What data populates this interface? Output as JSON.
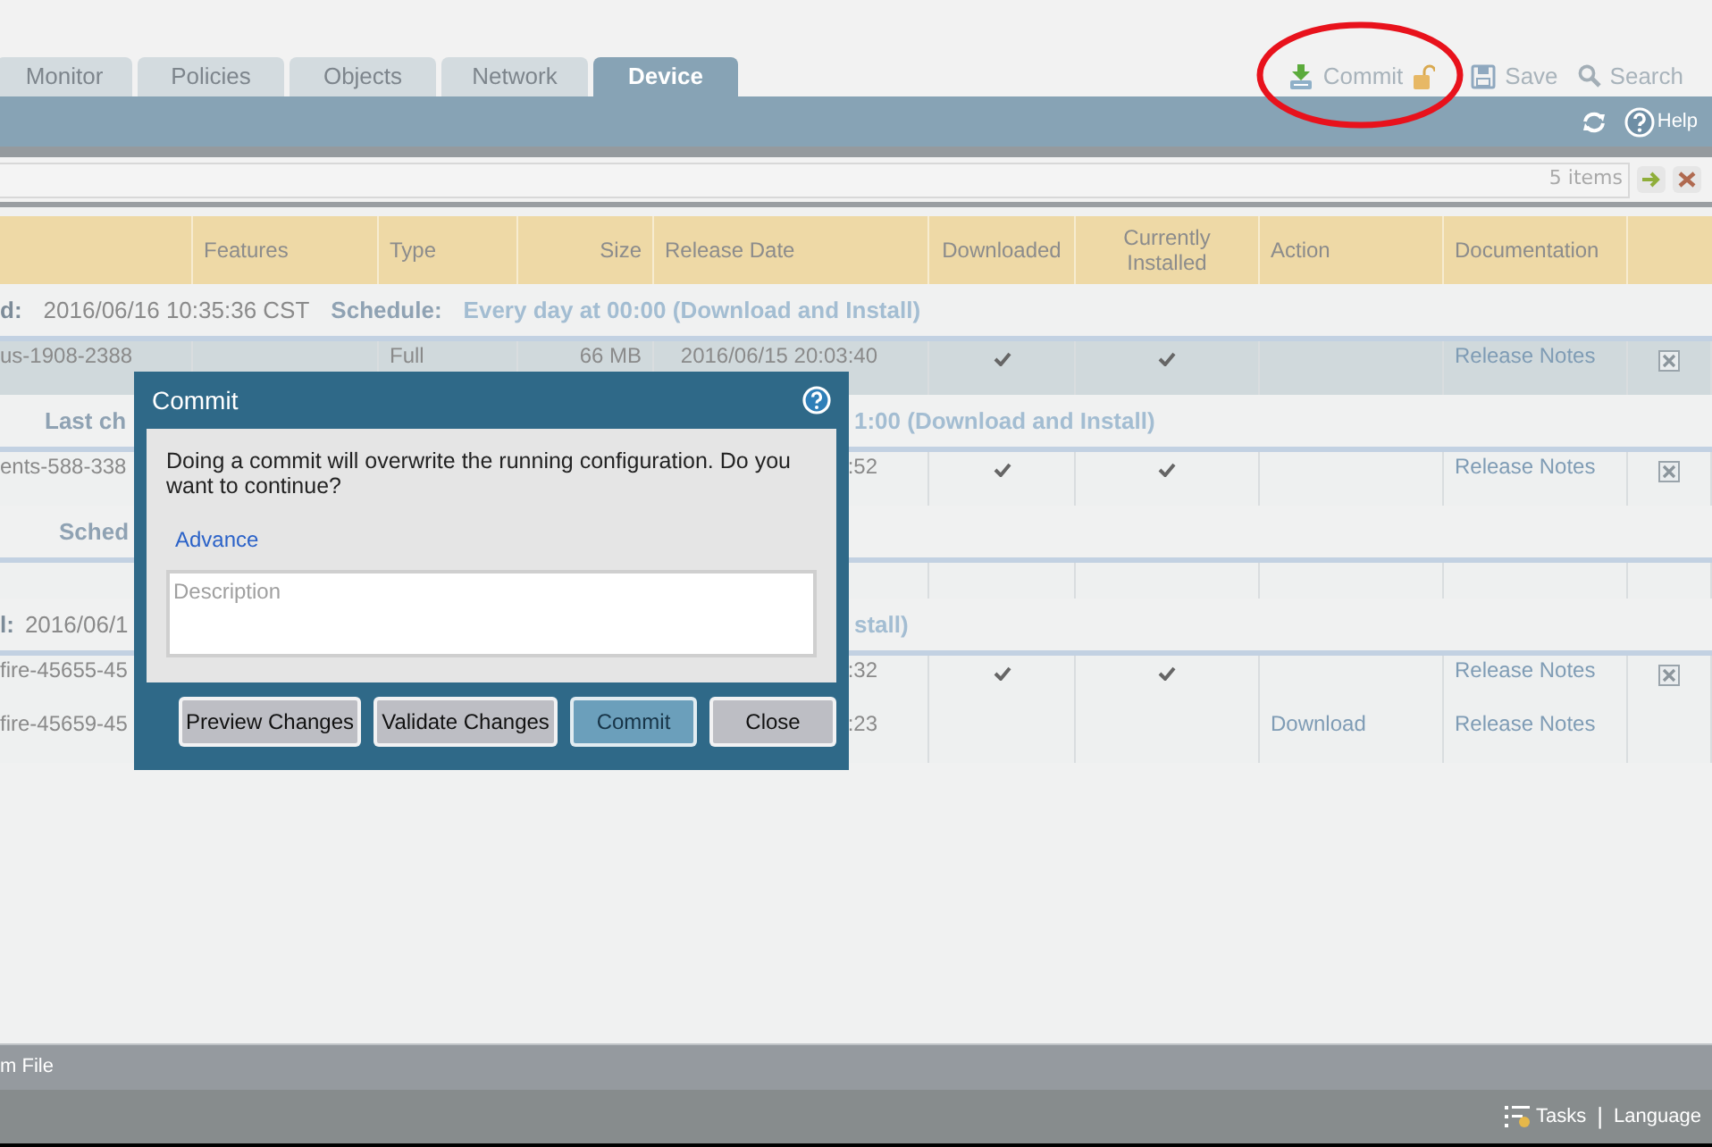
{
  "tabs": [
    {
      "label": "Monitor",
      "selected": false
    },
    {
      "label": "Policies",
      "selected": false
    },
    {
      "label": "Objects",
      "selected": false
    },
    {
      "label": "Network",
      "selected": false
    },
    {
      "label": "Device",
      "selected": true
    }
  ],
  "toolbar": {
    "commit": "Commit",
    "save": "Save",
    "search": "Search"
  },
  "subbar": {
    "help": "Help"
  },
  "filter": {
    "count": "5 items"
  },
  "table": {
    "columns": [
      "Features",
      "Type",
      "Size",
      "Release Date",
      "Downloaded",
      "Currently Installed",
      "Action",
      "Documentation"
    ],
    "rows": [
      {
        "kind": "group",
        "left": [
          {
            "text": "d:",
            "kind": "label"
          },
          {
            "text": "2016/06/16 10:35:36 CST",
            "kind": "value"
          },
          {
            "text": "Schedule:",
            "kind": "key"
          },
          {
            "text": "Every day at 00:00 (Download and Install)",
            "kind": "schedule"
          }
        ]
      },
      {
        "kind": "row",
        "selected": true,
        "name": "us-1908-2388",
        "type": "Full",
        "size": "66 MB",
        "date": "2016/06/15 20:03:40",
        "downloaded": true,
        "installed": true,
        "doc": "Release Notes",
        "removable": true
      },
      {
        "kind": "group",
        "left": [
          {
            "text": "Last ch",
            "kind": "key"
          }
        ],
        "right": [
          {
            "text": "1:00 (Download and Install)",
            "kind": "schedule"
          }
        ]
      },
      {
        "kind": "row",
        "selected": false,
        "name": "ents-588-338",
        "date": ":52",
        "downloaded": true,
        "installed": true,
        "doc": "Release Notes",
        "removable": true
      },
      {
        "kind": "group",
        "left": [
          {
            "text": "Sched",
            "kind": "key"
          }
        ]
      },
      {
        "kind": "row",
        "selected": false
      },
      {
        "kind": "group",
        "left": [
          {
            "text": "l:",
            "kind": "label"
          },
          {
            "text": "2016/06/1",
            "kind": "value"
          }
        ],
        "right": [
          {
            "text": "stall)",
            "kind": "schedule"
          }
        ]
      },
      {
        "kind": "row",
        "selected": false,
        "name": "fire-45655-45",
        "date": ":32",
        "downloaded": true,
        "installed": true,
        "doc": "Release Notes",
        "removable": true
      },
      {
        "kind": "row",
        "selected": false,
        "name": "fire-45659-45",
        "date": ":23",
        "downloaded": false,
        "installed": false,
        "action": "Download",
        "doc": "Release Notes",
        "removable": false
      }
    ]
  },
  "dialog": {
    "title": "Commit",
    "message": "Doing a commit will overwrite the running configuration. Do you want to continue?",
    "link": "Advance",
    "description": {
      "placeholder": "Description"
    },
    "buttons": [
      {
        "label": "Preview Changes",
        "primary": false
      },
      {
        "label": "Validate Changes",
        "primary": false
      },
      {
        "label": "Commit",
        "primary": true
      },
      {
        "label": "Close",
        "primary": false
      }
    ]
  },
  "footer": {
    "text": "m File"
  },
  "status_bar": {
    "tasks": "Tasks",
    "separator": "|",
    "language": "Language"
  }
}
